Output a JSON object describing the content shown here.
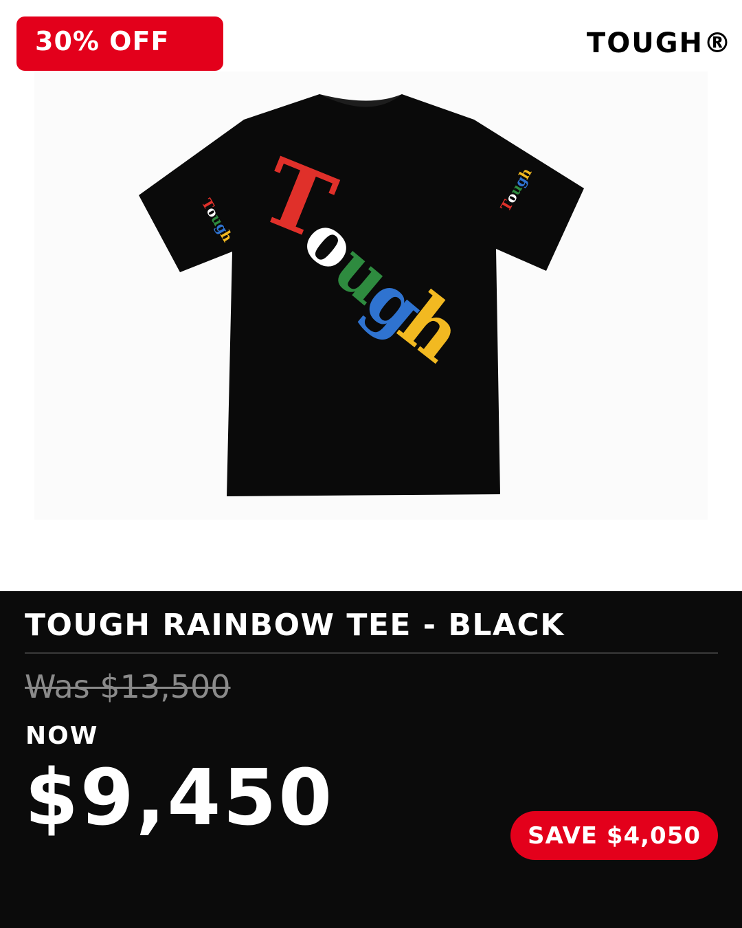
{
  "promo": {
    "discount_badge": "30% OFF",
    "brand": "TOUGH®"
  },
  "product": {
    "image_label": "Tough",
    "title": "TOUGH RAINBOW TEE - BLACK",
    "was_price": "Was $13,500",
    "now_label": "NOW",
    "now_price": "$9,450",
    "save_label": "SAVE $4,050"
  },
  "colors": {
    "accent_red": "#e3001b",
    "panel_bg": "#0b0b0b",
    "print_red": "#e0302a",
    "print_white": "#ffffff",
    "print_green": "#2e8b3f",
    "print_blue": "#2f73d0",
    "print_yellow": "#f2b921"
  }
}
